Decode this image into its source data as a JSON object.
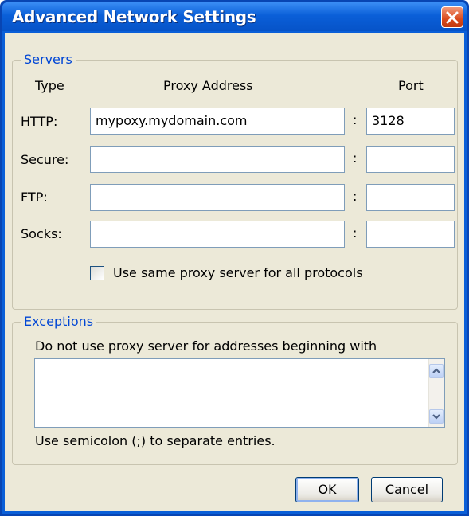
{
  "window": {
    "title": "Advanced Network Settings"
  },
  "servers": {
    "legend": "Servers",
    "headers": {
      "type": "Type",
      "address": "Proxy Address",
      "port": "Port"
    },
    "rows": [
      {
        "type": "HTTP:",
        "address": "mypoxy.mydomain.com",
        "port": "3128"
      },
      {
        "type": "Secure:",
        "address": "",
        "port": ""
      },
      {
        "type": "FTP:",
        "address": "",
        "port": ""
      },
      {
        "type": "Socks:",
        "address": "",
        "port": ""
      }
    ],
    "separator": ":",
    "same_proxy": {
      "label": "Use same proxy server for all protocols",
      "checked": false
    }
  },
  "exceptions": {
    "legend": "Exceptions",
    "description": "Do not use proxy server for addresses beginning with",
    "value": "",
    "hint": "Use semicolon (;) to separate entries."
  },
  "buttons": {
    "ok": "OK",
    "cancel": "Cancel"
  },
  "icons": {
    "close": "close-icon",
    "scroll_up": "chevron-up-icon",
    "scroll_down": "chevron-down-icon"
  },
  "colors": {
    "title_bar": "#0a5fd8",
    "close_button": "#d9491c",
    "group_legend": "#0046d5",
    "dialog_face": "#ece9d8"
  }
}
